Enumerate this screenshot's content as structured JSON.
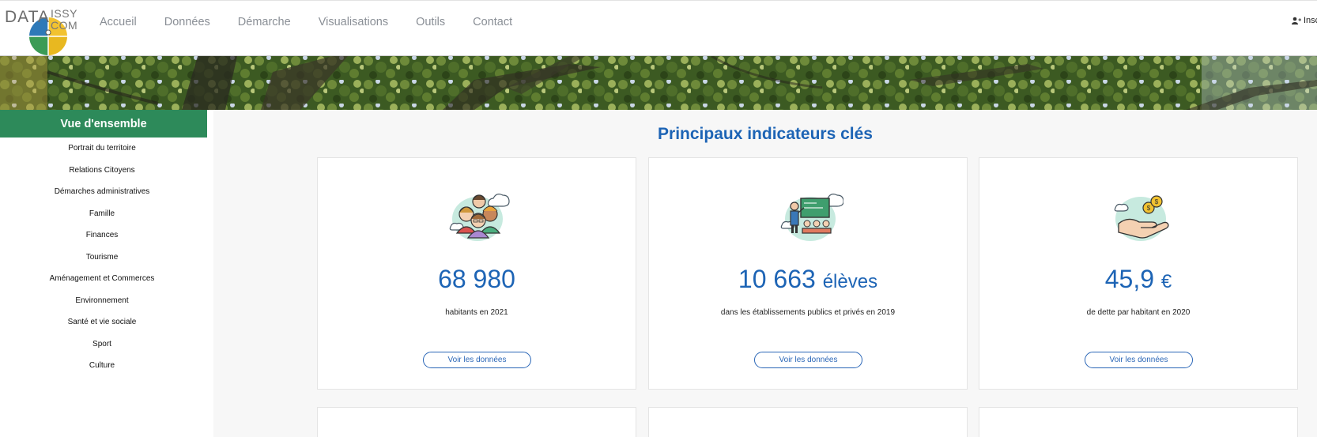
{
  "header": {
    "logo": {
      "data": "DATA",
      "issy": "ISSY",
      "com": "COM"
    },
    "nav": [
      "Accueil",
      "Données",
      "Démarche",
      "Visualisations",
      "Outils",
      "Contact"
    ],
    "login_label": "Inscr"
  },
  "sidebar": {
    "title": "Vue d'ensemble",
    "items": [
      "Portrait du territoire",
      "Relations Citoyens",
      "Démarches administratives",
      "Famille",
      "Finances",
      "Tourisme",
      "Aménagement et Commerces",
      "Environnement",
      "Santé et vie sociale",
      "Sport",
      "Culture"
    ]
  },
  "main": {
    "title": "Principaux indicateurs clés",
    "cards": [
      {
        "icon": "people-icon",
        "value": "68 980",
        "unit": "",
        "description": "habitants en 2021",
        "button": "Voir les données"
      },
      {
        "icon": "classroom-icon",
        "value": "10 663",
        "unit": "élèves",
        "description": "dans les établissements publics et privés en 2019",
        "button": "Voir les données"
      },
      {
        "icon": "coins-hand-icon",
        "value": "45,9",
        "unit": "€",
        "description": "de dette par habitant en 2020",
        "button": "Voir les données"
      }
    ]
  },
  "colors": {
    "accent_blue": "#1d64b5",
    "sidebar_green": "#2d8a5a",
    "nav_gray": "#8a8f96"
  }
}
